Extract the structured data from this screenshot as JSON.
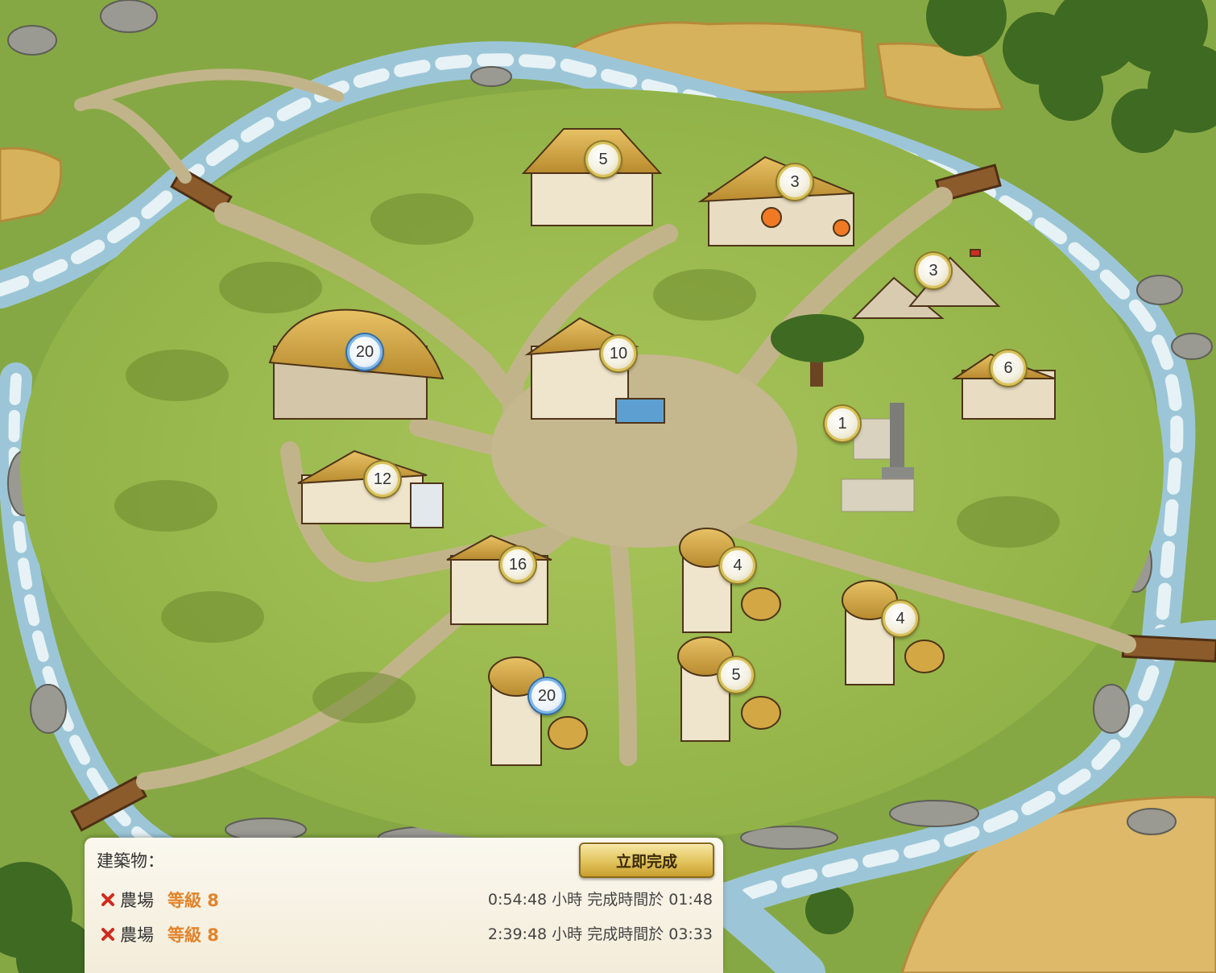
{
  "map": {
    "buildings": [
      {
        "id": "tavern",
        "level": "5",
        "max": false
      },
      {
        "id": "blacksmith",
        "level": "3",
        "max": false
      },
      {
        "id": "barracks",
        "level": "3",
        "max": false
      },
      {
        "id": "stable",
        "level": "6",
        "max": false
      },
      {
        "id": "town-hall",
        "level": "20",
        "max": true
      },
      {
        "id": "workshop",
        "level": "10",
        "max": false
      },
      {
        "id": "statue",
        "level": "1",
        "max": false
      },
      {
        "id": "farm-main",
        "level": "12",
        "max": false
      },
      {
        "id": "warehouse",
        "level": "16",
        "max": false
      },
      {
        "id": "granary-a",
        "level": "4",
        "max": false
      },
      {
        "id": "granary-b",
        "level": "4",
        "max": false
      },
      {
        "id": "granary-c",
        "level": "5",
        "max": false
      },
      {
        "id": "granary-d",
        "level": "20",
        "max": true
      }
    ],
    "empty_plots": 9
  },
  "queue": {
    "title": "建築物：",
    "finish_now_label": "立即完成",
    "items": [
      {
        "name": "農場",
        "level": "等級 8",
        "time": "0:54:48 小時 完成時間於 01:48"
      },
      {
        "name": "農場",
        "level": "等級 8",
        "time": "2:39:48 小時 完成時間於 03:33"
      }
    ]
  }
}
